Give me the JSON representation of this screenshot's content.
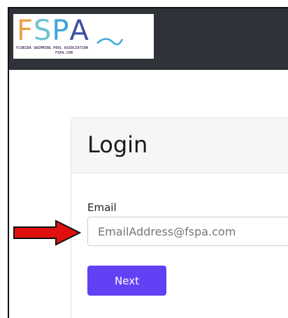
{
  "header": {
    "logo": {
      "letters": [
        "F",
        "S",
        "P",
        "A"
      ],
      "letter_colors": [
        "#e9a24a",
        "#6cc2cf",
        "#3aa7d8",
        "#3f4fa0"
      ],
      "subtitle": "FLORIDA SWIMMING POOL ASSOCIATION",
      "domain": "FSPA.COM"
    }
  },
  "login": {
    "title": "Login",
    "email_label": "Email",
    "email_placeholder": "EmailAddress@fspa.com",
    "next_label": "Next"
  },
  "colors": {
    "topbar": "#2f3238",
    "accent": "#6241f5",
    "arrow": "#e01010"
  }
}
